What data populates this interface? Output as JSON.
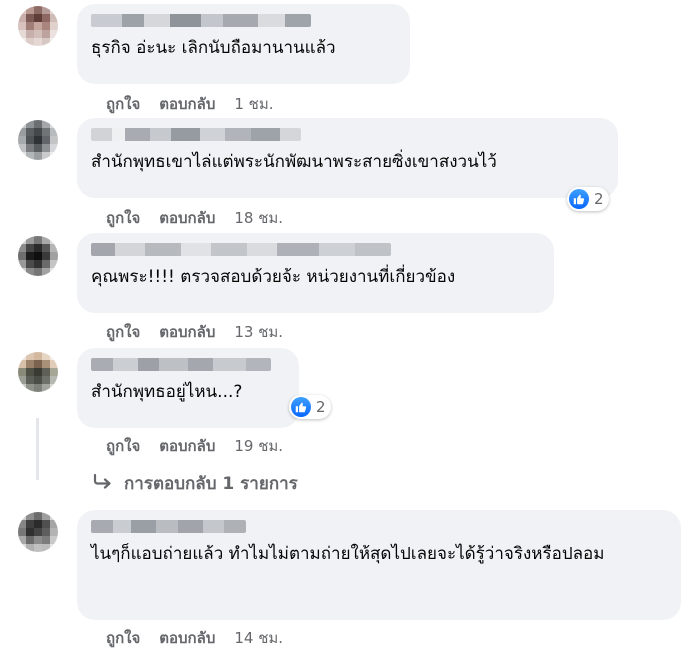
{
  "comments": [
    {
      "text": "ธุรกิจ อ่ะนะ เลิกนับถือมานานแล้ว",
      "actions": {
        "like": "ถูกใจ",
        "reply": "ตอบกลับ",
        "time": "1 ชม."
      }
    },
    {
      "text": "สำนักพุทธเขาไล่แต่พระนักพัฒนาพระสายซิ่งเขาสงวนไว้",
      "reaction_count": "2",
      "actions": {
        "like": "ถูกใจ",
        "reply": "ตอบกลับ",
        "time": "18 ชม."
      }
    },
    {
      "text": "คุณพระ!!!! ตรวจสอบด้วยจ้ะ หน่วยงานที่เกี่ยวข้อง",
      "actions": {
        "like": "ถูกใจ",
        "reply": "ตอบกลับ",
        "time": "13 ชม."
      }
    },
    {
      "text": "สำนักพุทธอยู่ไหน...?",
      "reaction_count": "2",
      "actions": {
        "like": "ถูกใจ",
        "reply": "ตอบกลับ",
        "time": "19 ชม."
      }
    },
    {
      "text": "ไนๆก็แอบถ่ายแล้ว ทำไมไม่ตามถ่ายให้สุดไปเลยจะได้รู้ว่าจริงหรือปลอม",
      "actions": {
        "like": "ถูกใจ",
        "reply": "ตอบกลับ",
        "time": "14 ชม."
      }
    }
  ],
  "view_replies": {
    "label": "การตอบกลับ 1 รายการ",
    "icon": "reply-arrow-icon"
  },
  "colors": {
    "bubble": "#f0f2f5",
    "meta": "#65676b",
    "like_blue": "#0866ff"
  }
}
